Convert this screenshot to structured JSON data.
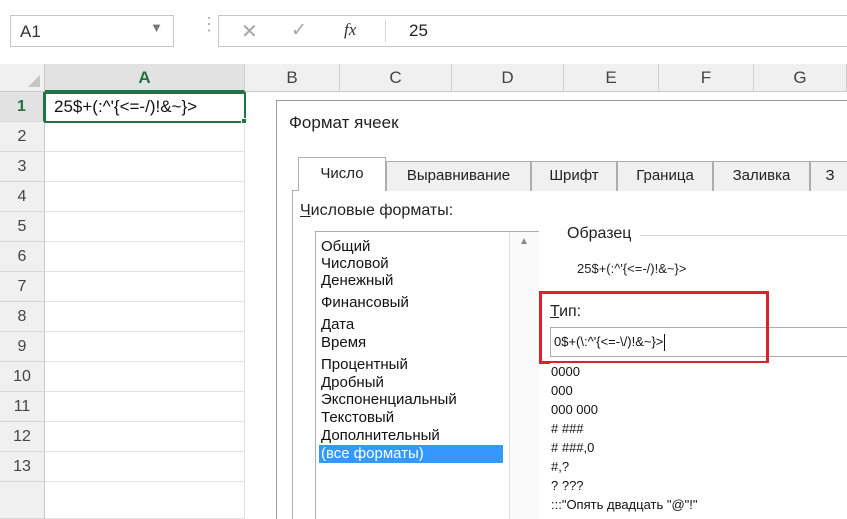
{
  "formula_bar": {
    "name_box": "A1",
    "cancel_icon": "✕",
    "enter_icon": "✓",
    "fx_label": "fx",
    "value": "25"
  },
  "grid": {
    "columns": [
      "A",
      "B",
      "C",
      "D",
      "E",
      "F",
      "G"
    ],
    "rows": [
      "1",
      "2",
      "3",
      "4",
      "5",
      "6",
      "7",
      "8",
      "9",
      "10",
      "11",
      "12",
      "13"
    ],
    "cell_a1": "25$+(:^'{<=-/)!&~}>",
    "selected_color": "#217346"
  },
  "dialog": {
    "title": "Формат ячеек",
    "tabs": [
      "Число",
      "Выравнивание",
      "Шрифт",
      "Граница",
      "Заливка",
      "З"
    ],
    "category_label_underlined": "Ч",
    "category_label_rest": "исловые форматы:",
    "categories": [
      "Общий",
      "Числовой",
      "Денежный",
      "Финансовый",
      "Дата",
      "Время",
      "Процентный",
      "Дробный",
      "Экспоненциальный",
      "Текстовый",
      "Дополнительный",
      "(все форматы)"
    ],
    "selected_category": "(все форматы)",
    "sample_label": "Образец",
    "sample_value": "25$+(:^'{<=-/)!&~}>",
    "type_label_underlined": "Т",
    "type_label_rest": "ип:",
    "type_value": "0$+(\\:^'{<=-\\/)!&~}>",
    "format_list": [
      "0000",
      "000",
      "000 000",
      "# ###",
      "# ###,0",
      "#,?",
      "? ???",
      ":::\"Опять двадцать \"@\"!\""
    ],
    "highlight_color": "#d9232e"
  }
}
